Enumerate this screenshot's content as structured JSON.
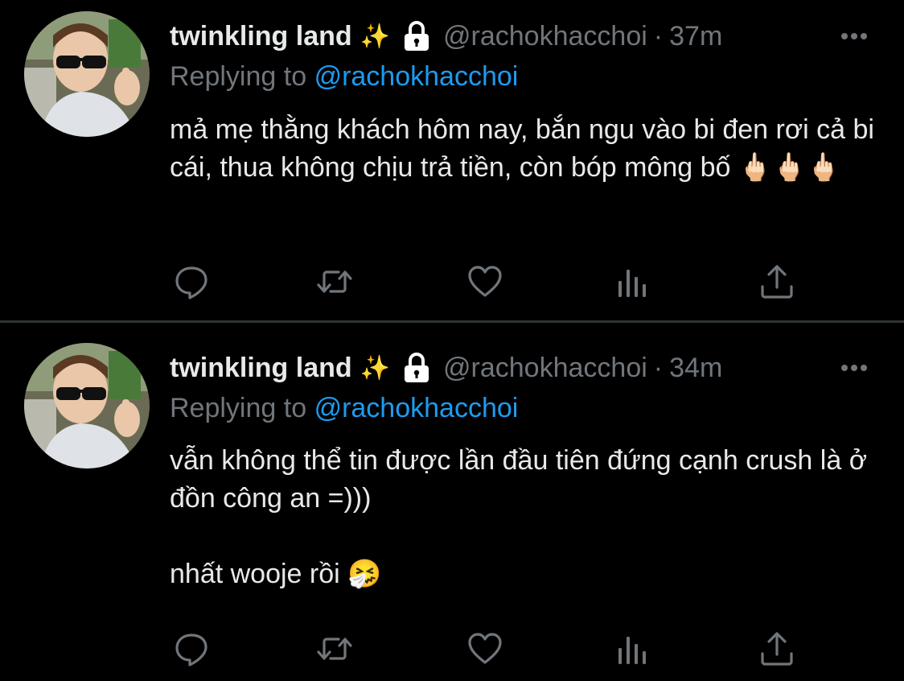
{
  "tweets": [
    {
      "display_name": "twinkling land",
      "name_emoji": "✨",
      "handle": "@rachokhacchoi",
      "separator": "·",
      "time": "37m",
      "replying_prefix": "Replying to",
      "replying_to": "@rachokhacchoi",
      "body": [
        "mả mẹ thằng khách hôm nay, bắn ngu vào bi đen rơi cả bi cái, thua không chịu trả tiền, còn bóp mông bố 🖕🏻🖕🏻🖕🏻"
      ]
    },
    {
      "display_name": "twinkling land",
      "name_emoji": "✨",
      "handle": "@rachokhacchoi",
      "separator": "·",
      "time": "34m",
      "replying_prefix": "Replying to",
      "replying_to": "@rachokhacchoi",
      "body": [
        "vẫn không thể tin được lần đầu tiên đứng cạnh crush là ở đồn công an =)))",
        "",
        "nhất wooje rồi 🤧"
      ]
    }
  ],
  "icons": {
    "reply": "reply-icon",
    "retweet": "retweet-icon",
    "like": "heart-icon",
    "views": "views-icon",
    "share": "share-icon",
    "protected": "lock-icon",
    "more": "more-icon"
  },
  "colors": {
    "background": "#000000",
    "text_primary": "#e7e9ea",
    "text_secondary": "#71767b",
    "link": "#1d9bf0",
    "divider": "#2f3336"
  }
}
